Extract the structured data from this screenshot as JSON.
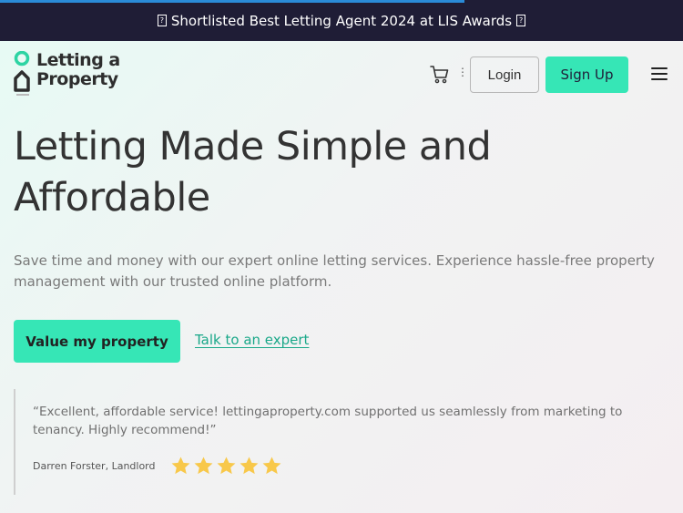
{
  "banner": {
    "text": "Shortlisted Best Letting Agent 2024 at LIS Awards",
    "glyph_left": "?",
    "glyph_right": "?",
    "progress": 0.68
  },
  "header": {
    "logo_line1": "Letting a",
    "logo_line2": "Property",
    "login_label": "Login",
    "signup_label": "Sign Up",
    "cart_icon": "cart-icon",
    "menu_icon": "hamburger-icon"
  },
  "hero": {
    "title": "Letting Made Simple and Affordable",
    "subtitle": "Save time and money with our expert online letting services. Experience hassle-free property management with our trusted online platform.",
    "primary_cta": "Value my property",
    "secondary_cta": "Talk to an expert"
  },
  "testimonial": {
    "quote": "“Excellent, affordable service! lettingaproperty.com supported us seamlessly from marketing to tenancy. Highly recommend!”",
    "author": "Darren Forster, Landlord",
    "rating": 5,
    "rating_max": 5
  },
  "colors": {
    "accent": "#36e6b6",
    "banner_bg": "#1f1d36",
    "link": "#1aa889",
    "star": "#f8c84a"
  }
}
